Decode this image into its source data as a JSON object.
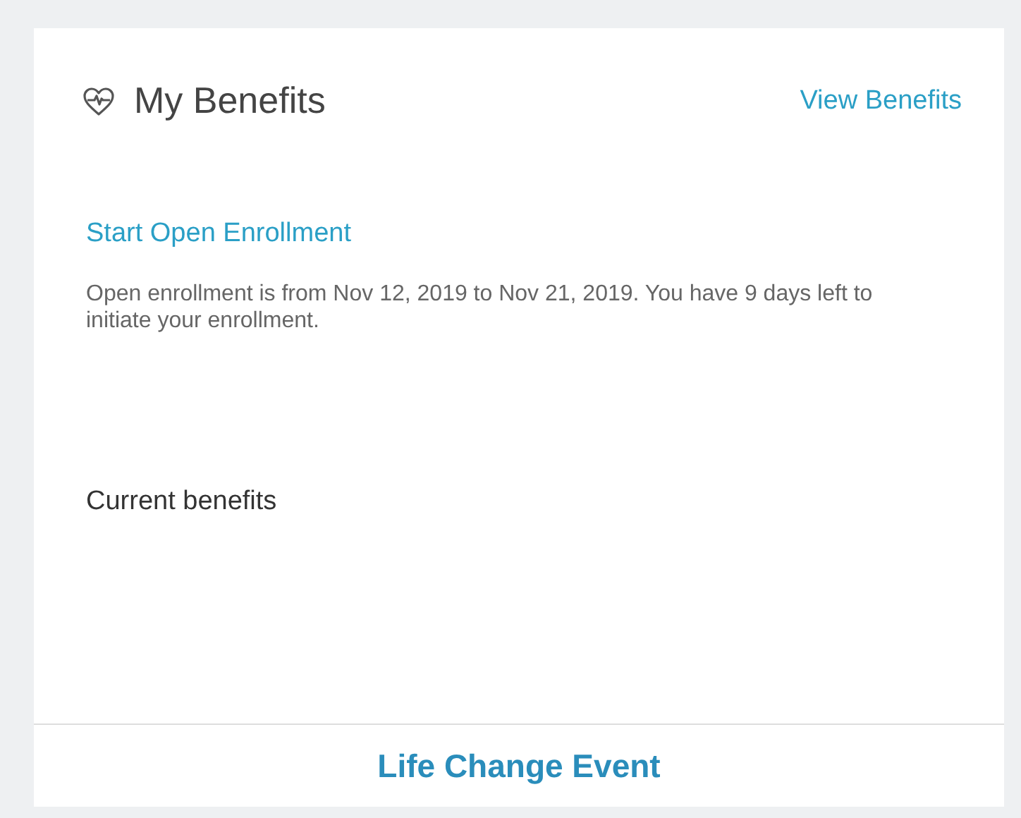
{
  "card": {
    "title": "My Benefits",
    "header_link": "View Benefits",
    "action_link": "Start Open Enrollment",
    "description": "Open enrollment is from Nov 12, 2019 to Nov 21, 2019. You have 9 days left to initiate your enrollment.",
    "section_label": "Current benefits",
    "footer_link": "Life Change Event"
  }
}
